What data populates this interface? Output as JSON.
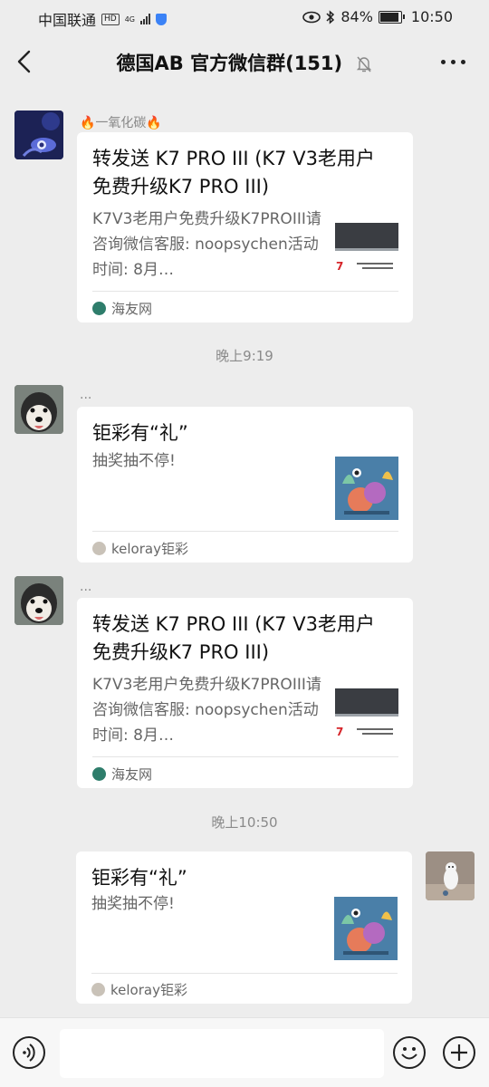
{
  "status_bar": {
    "carrier": "中国联通",
    "hd_badge": "HD",
    "network": "4G",
    "battery": "84%",
    "battery_level": 0.84,
    "time": "10:50"
  },
  "header": {
    "title": "德国AB  官方微信群(151)"
  },
  "messages": [
    {
      "sender": "🔥一氧化碳🔥",
      "title": "转发送 K7 PRO III (K7 V3老用户免费升级K7 PRO III)",
      "description": "K7V3老用户免费升级K7PROIII请咨询微信客服: noopsychen活动时间: 8月…",
      "source": "海友网"
    },
    {
      "timestamp": "晚上9:19"
    },
    {
      "sender": "...",
      "title": "钜彩有“礼”",
      "description": "抽奖抽不停!",
      "source": "keloray钜彩"
    },
    {
      "sender": "...",
      "title": "转发送 K7 PRO III (K7 V3老用户免费升级K7 PRO III)",
      "description": "K7V3老用户免费升级K7PROIII请咨询微信客服: noopsychen活动时间: 8月…",
      "source": "海友网"
    },
    {
      "timestamp": "晚上10:50"
    },
    {
      "title": "钜彩有“礼”",
      "description": "抽奖抽不停!",
      "source": "keloray钜彩"
    }
  ],
  "colors": {
    "background": "#ededed",
    "card": "#ffffff",
    "source_haiyou": "#2e7d6b"
  }
}
